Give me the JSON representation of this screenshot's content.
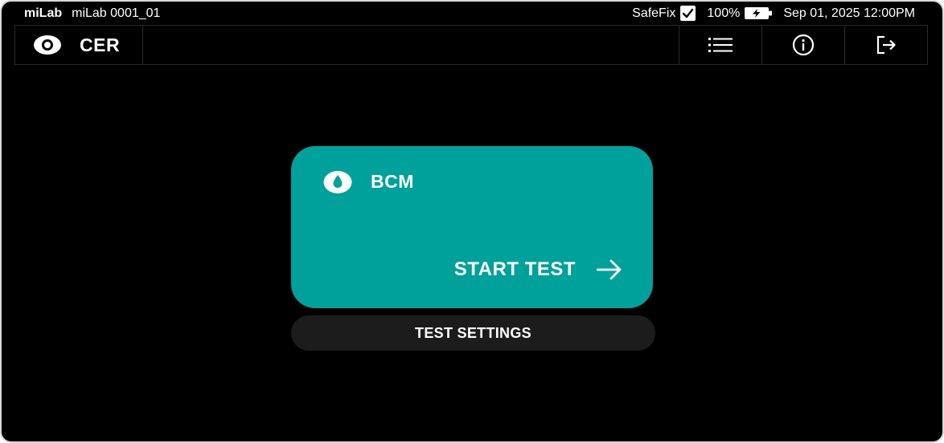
{
  "statusbar": {
    "brand": "miLab",
    "device": "miLab 0001_01",
    "safefix_label": "SafeFix",
    "safefix_checked": true,
    "battery_percent": "100%",
    "battery_icon": "battery-charging-icon",
    "datetime": "Sep 01, 2025 12:00PM"
  },
  "header": {
    "title": "CER",
    "title_icon": "eye-icon",
    "buttons": [
      {
        "icon": "list-icon"
      },
      {
        "icon": "info-icon"
      },
      {
        "icon": "logout-icon"
      }
    ]
  },
  "card": {
    "test_name": "BCM",
    "test_icon": "drop-icon",
    "start_label": "START TEST",
    "start_icon": "arrow-right-icon",
    "color": "#00a19a"
  },
  "settings_label": "TEST SETTINGS"
}
